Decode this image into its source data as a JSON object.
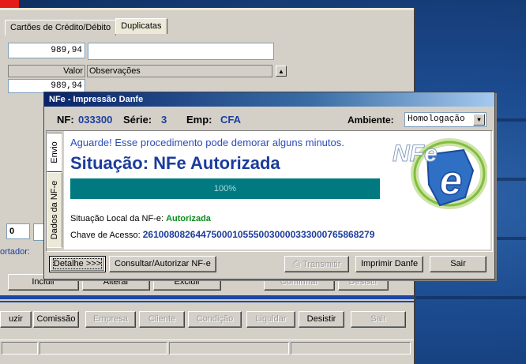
{
  "background": {
    "tabs": [
      "Cartões de Crédito/Débito",
      "Duplicatas"
    ],
    "amount_value": "989,94",
    "grid_header_valor": "Valor",
    "grid_header_obs": "Observações",
    "grid_row_value": "989,94",
    "input_left_value": "0",
    "exportador_label": "ortador:",
    "row1_buttons": [
      "Incluir",
      "Alterar",
      "Excluir",
      "Confirmar",
      "Desistir"
    ],
    "row2_buttons": [
      "uzir",
      "Comissão",
      "Empresa",
      "Cliente",
      "Condição",
      "Liquidar",
      "Desistir",
      "Sair"
    ]
  },
  "dialog": {
    "title": "NFe - Impressão Danfe",
    "nf_label": "NF:",
    "nf_value": "033300",
    "serie_label": "Série:",
    "serie_value": "3",
    "emp_label": "Emp:",
    "emp_value": "CFA",
    "ambiente_label": "Ambiente:",
    "ambiente_value": "Homologação",
    "vtabs": [
      "Envio",
      "Dados da NF-e"
    ],
    "message": "Aguarde! Esse procedimento pode demorar alguns minutos.",
    "situacao": "Situação: NFe Autorizada",
    "progress": {
      "percent": 100,
      "label": "100%"
    },
    "local_label": "Situação Local da NF-e:",
    "local_value": "Autorizada",
    "chave_label": "Chave de Acesso:",
    "chave_value": "26100808264475000105550030000333000765868279",
    "logo_text": "NFe",
    "buttons": {
      "detalhe": "Detalhe >>>",
      "consultar": "Consultar/Autorizar NF-e",
      "transmitir": "Transmitir",
      "imprimir": "Imprimir Danfe",
      "sair": "Sair"
    }
  },
  "colors": {
    "title_start": "#0a246a",
    "progress": "#007a80",
    "accent_blue": "#1b3c9c",
    "ok_green": "#0b8c1e"
  }
}
